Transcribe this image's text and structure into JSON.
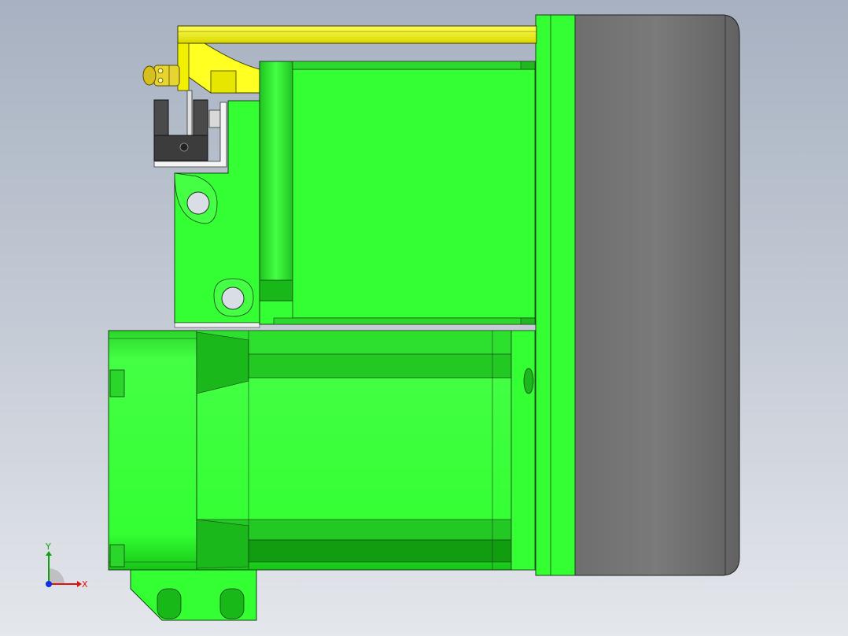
{
  "triad": {
    "x_label": "X",
    "y_label": "Y"
  },
  "colors": {
    "background_top": "#a7b1c1",
    "background_bottom": "#e4e7ec",
    "green_part": "#33ff33",
    "green_shadow": "#10b810",
    "yellow_part": "#ffff33",
    "grey_plate": "#767676",
    "sensor": "#444444",
    "edge": "#1b3d1b",
    "axis_x": "#e01010",
    "axis_y": "#10a010",
    "axis_z": "#1030e0"
  },
  "icons": {
    "triad": "coordinate-triad-icon"
  }
}
